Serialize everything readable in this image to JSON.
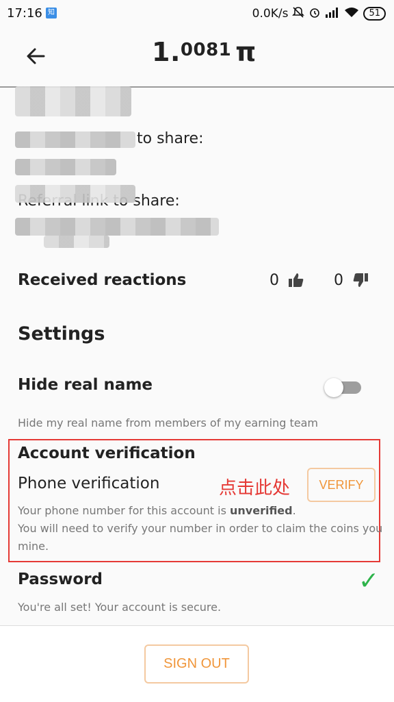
{
  "statusbar": {
    "time": "17:16",
    "notif": "知",
    "speed": "0.0K/s",
    "battery": "51"
  },
  "header": {
    "balance_int": "1.",
    "balance_frac": "0081",
    "currency": "π"
  },
  "profile": {
    "invite_label_tail": "to share:",
    "referral_label": "Referral link to share:"
  },
  "reactions": {
    "title": "Received reactions",
    "likes": "0",
    "dislikes": "0"
  },
  "settings": {
    "title": "Settings",
    "hide_name": {
      "title": "Hide real name",
      "desc": "Hide my real name from members of my earning team",
      "enabled": false
    },
    "account_verification": {
      "title": "Account verification",
      "phone_label": "Phone verification",
      "annotation": "点击此处",
      "verify_label": "VERIFY",
      "desc_prefix": "Your phone number for this account is ",
      "status": "unverified",
      "desc_suffix": ".",
      "desc_line2": "You will need to verify your number in order to claim the coins you",
      "desc_line3": "mine."
    },
    "password": {
      "title": "Password",
      "desc": "You're all set! Your account is secure.",
      "check": "✓"
    }
  },
  "footer": {
    "signout_label": "SIGN OUT"
  },
  "colors": {
    "accent": "#f0963a",
    "annotation_red": "#e53935",
    "success_green": "#2db34a"
  }
}
